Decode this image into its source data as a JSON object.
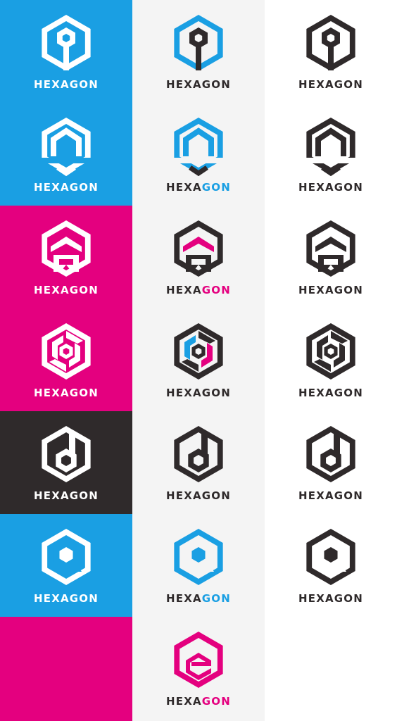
{
  "brand": {
    "wordmark_parts": [
      "HEXA",
      "GON"
    ]
  },
  "colors": {
    "blue": "#1a9fe3",
    "magenta": "#e4007f",
    "dark": "#2f2a2b",
    "white": "#ffffff",
    "light_panel": "#f4f4f4"
  },
  "rows": [
    {
      "variant": "pin",
      "bg": "#1a9fe3",
      "mid_mark": "#1a9fe3",
      "mid_accent": "#2f2a2b",
      "gon_color": "#2f2a2b"
    },
    {
      "variant": "house",
      "bg": "#1a9fe3",
      "mid_mark": "#1a9fe3",
      "mid_accent": "#2f2a2b",
      "gon_color": "#1a9fe3"
    },
    {
      "variant": "cap",
      "bg": "#e4007f",
      "mid_mark": "#2f2a2b",
      "mid_accent": "#e4007f",
      "gon_color": "#e4007f"
    },
    {
      "variant": "swirl",
      "bg": "#e4007f",
      "mid_mark": "#2f2a2b",
      "mid_accent": "#1a9fe3",
      "mid_accent2": "#e4007f",
      "gon_color": "#2f2a2b"
    },
    {
      "variant": "nut",
      "bg": "#2f2a2b",
      "mid_mark": "#2f2a2b",
      "mid_accent": "#2f2a2b",
      "gon_color": "#2f2a2b"
    },
    {
      "variant": "q",
      "bg": "#1a9fe3",
      "mid_mark": "#1a9fe3",
      "mid_accent": "#2f2a2b",
      "gon_color": "#1a9fe3"
    },
    {
      "variant": "e",
      "bg": "#e4007f",
      "mid_mark": "#e4007f",
      "mid_accent": "#e4007f",
      "gon_color": "#e4007f",
      "only_middle": true
    }
  ]
}
